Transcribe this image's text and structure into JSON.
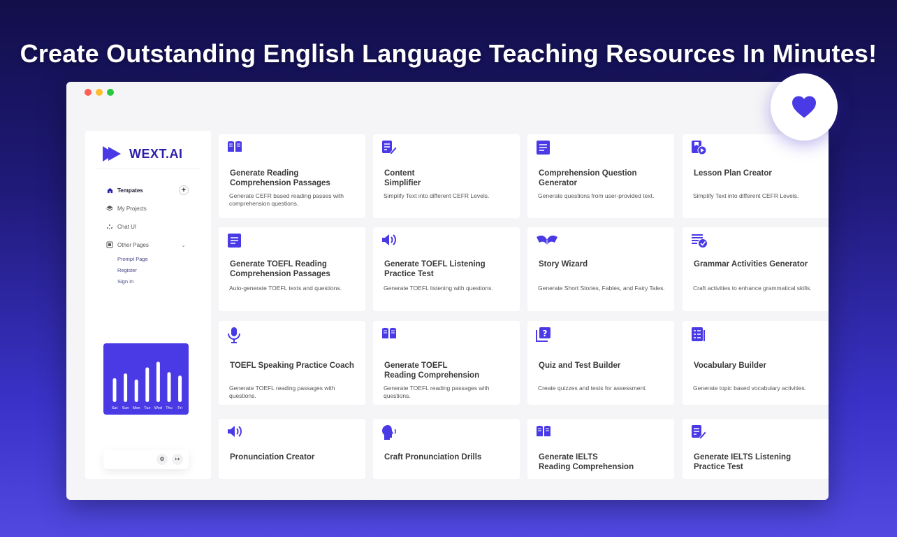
{
  "hero": {
    "title": "Create Outstanding English Language Teaching Resources In Minutes!"
  },
  "colors": {
    "accent": "#4a3ae6",
    "brand_text": "#2b1fa8",
    "dot_red": "#ff5f57",
    "dot_yellow": "#febc2e",
    "dot_green": "#28c840"
  },
  "badge": {
    "icon": "heart-icon"
  },
  "sidebar": {
    "logo": "WEXT.AI",
    "nav": [
      {
        "label": "Tempates",
        "icon": "home-icon"
      },
      {
        "label": "My Projects",
        "icon": "layers-icon"
      },
      {
        "label": "Chat UI",
        "icon": "sparkle-icon"
      },
      {
        "label": "Other Pages",
        "icon": "pages-icon"
      }
    ],
    "subnav": [
      "Prompt Page",
      "Register",
      "Sign In"
    ],
    "chart": {
      "days": [
        "Sat",
        "Sun",
        "Mon",
        "Tue",
        "Wed",
        "Thu",
        "Fri"
      ],
      "levels": [
        0.55,
        0.66,
        0.52,
        0.8,
        0.93,
        0.69,
        0.61
      ]
    }
  },
  "cards": [
    {
      "title": "Generate Reading\nComprehension Passages",
      "desc": "Generate CEFR based reading passes with comprehension questions.",
      "icon": "book-icon"
    },
    {
      "title": "Content\nSimplifier",
      "desc": "Simplify Text into different CEFR Levels.",
      "icon": "edit-doc-icon"
    },
    {
      "title": "Comprehension Question Generator",
      "desc": "Generate questions from user-provided text.",
      "icon": "document-icon"
    },
    {
      "title": "Lesson Plan Creator",
      "desc": "Simplify Text into different CEFR Levels.",
      "icon": "video-doc-icon"
    },
    {
      "title": "Generate TOEFL Reading Comprehension Passages",
      "desc": "Auto-generate TOEFL texts and questions.",
      "icon": "document-icon"
    },
    {
      "title": "Generate TOEFL Listening Practice Test",
      "desc": "Generate TOEFL listening with questions.",
      "icon": "speaker-icon"
    },
    {
      "title": "Story Wizard",
      "desc": "Generate Short Stories, Fables, and Fairy Tales.",
      "icon": "open-book-icon"
    },
    {
      "title": "Grammar Activities Generator",
      "desc": "Craft activities to enhance grammatical skills.",
      "icon": "checklist-icon"
    },
    {
      "title": "TOEFL Speaking Practice Coach",
      "desc": "Generate TOEFL reading passages with questions.",
      "icon": "microphone-icon"
    },
    {
      "title": "Generate TOEFL\nReading Comprehension",
      "desc": "Generate TOEFL reading passages with questions.",
      "icon": "book-icon"
    },
    {
      "title": "Quiz and Test Builder",
      "desc": "Create quizzes and tests for assessment.",
      "icon": "question-icon"
    },
    {
      "title": "Vocabulary Builder",
      "desc": "Generate topic based vocabulary activities.",
      "icon": "list-icon"
    },
    {
      "title": "Pronunciation Creator",
      "desc": "",
      "icon": "speaker-icon"
    },
    {
      "title": "Craft Pronunciation Drills",
      "desc": "",
      "icon": "head-speaking-icon"
    },
    {
      "title": "Generate IELTS\nReading Comprehension",
      "desc": "",
      "icon": "book-icon"
    },
    {
      "title": "Generate IELTS Listening Practice Test",
      "desc": "",
      "icon": "edit-doc-icon"
    }
  ]
}
